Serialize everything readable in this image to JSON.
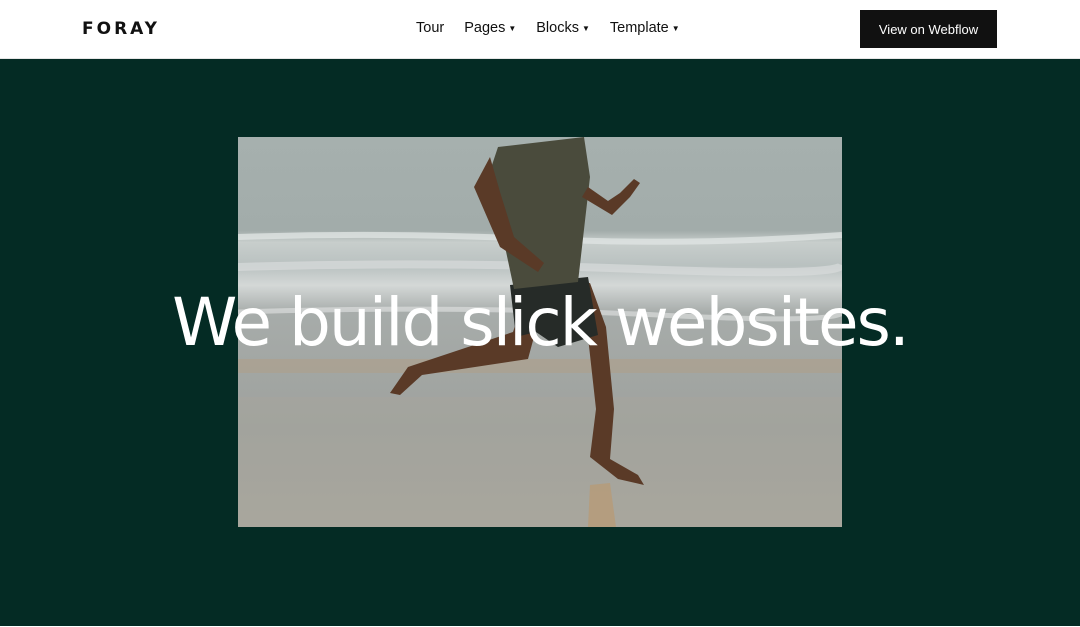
{
  "brand": {
    "logo_text": "FORAY"
  },
  "nav": {
    "items": [
      {
        "label": "Tour",
        "has_dropdown": false
      },
      {
        "label": "Pages",
        "has_dropdown": true
      },
      {
        "label": "Blocks",
        "has_dropdown": true
      },
      {
        "label": "Template",
        "has_dropdown": true
      }
    ],
    "cta_label": "View on Webflow"
  },
  "hero": {
    "headline": "We build slick websites.",
    "background_color": "#042b24",
    "image_subject": "man running barefoot on a beach"
  }
}
